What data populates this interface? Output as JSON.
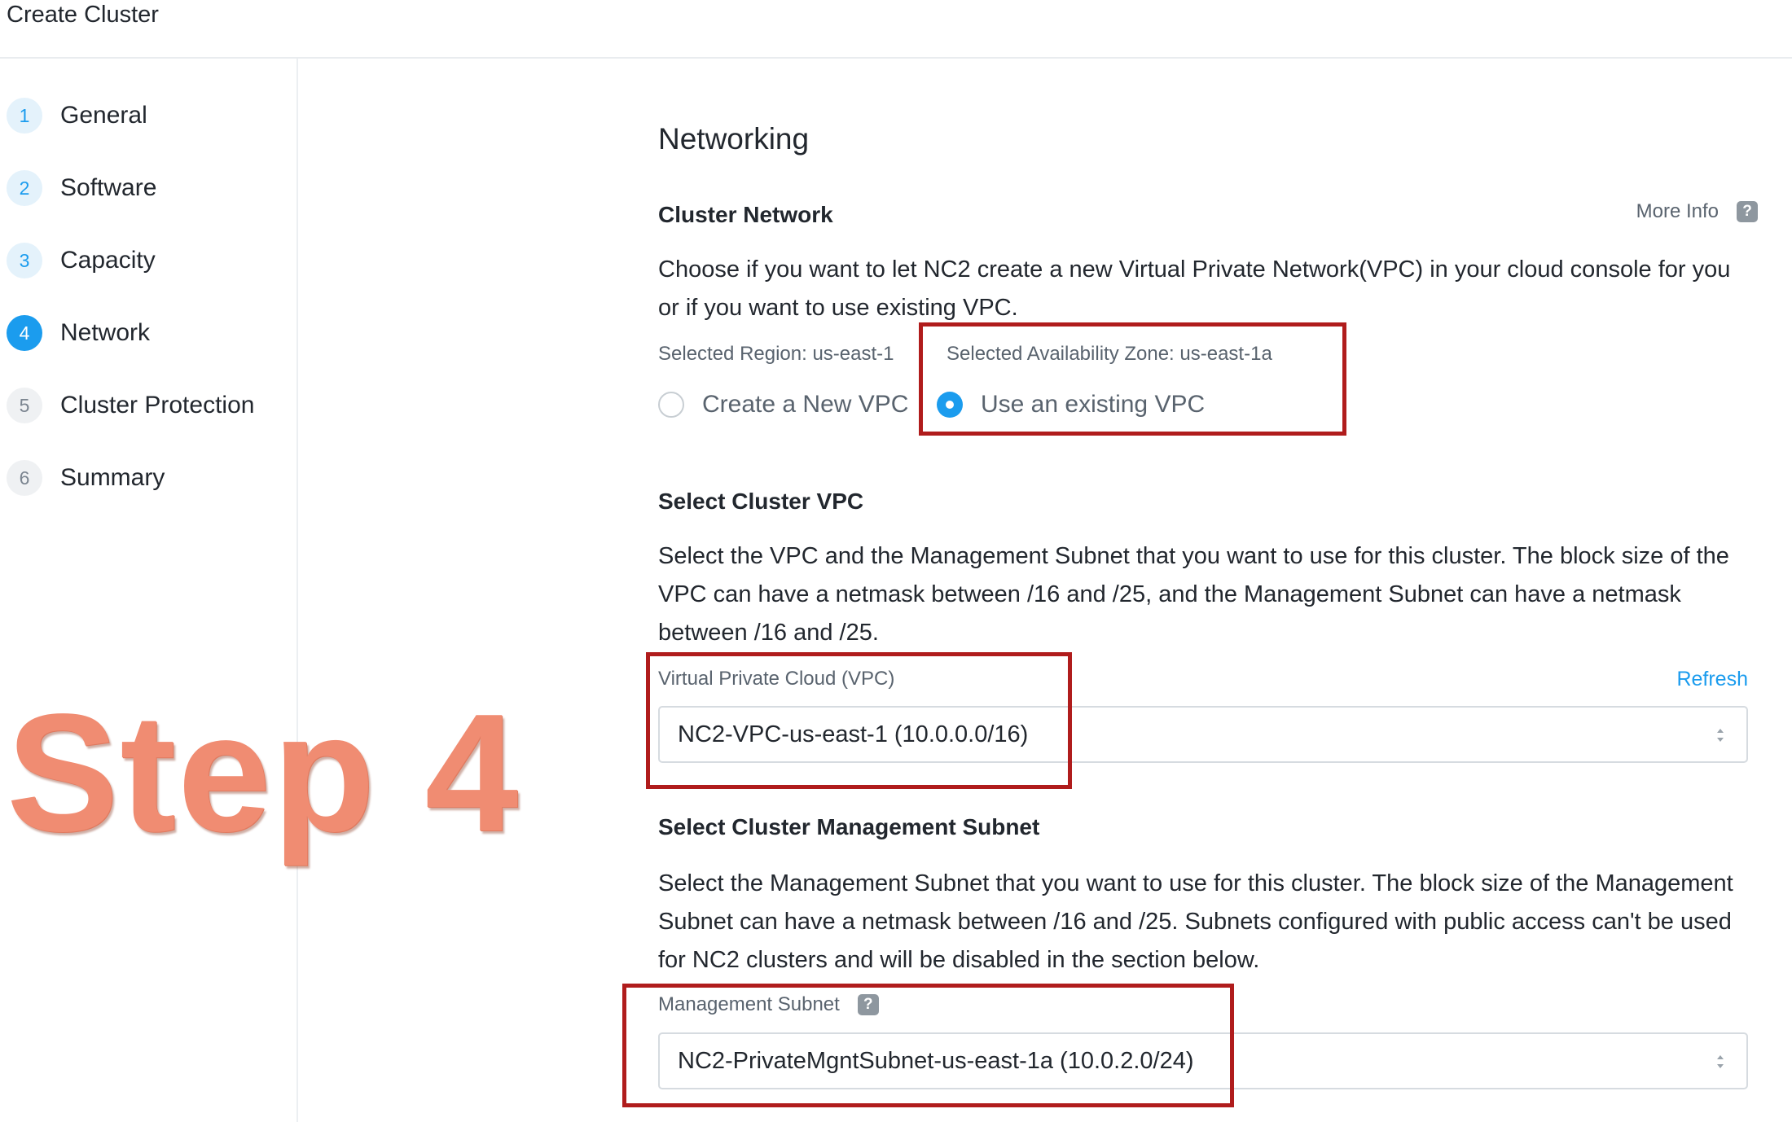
{
  "header": {
    "title": "Create Cluster"
  },
  "sidebar": {
    "steps": [
      {
        "num": "1",
        "label": "General",
        "state": "done"
      },
      {
        "num": "2",
        "label": "Software",
        "state": "done"
      },
      {
        "num": "3",
        "label": "Capacity",
        "state": "done"
      },
      {
        "num": "4",
        "label": "Network",
        "state": "active"
      },
      {
        "num": "5",
        "label": "Cluster Protection",
        "state": "pending"
      },
      {
        "num": "6",
        "label": "Summary",
        "state": "pending"
      }
    ]
  },
  "overlay": {
    "step_text": "Step 4",
    "color": "#f08c72",
    "highlight_color": "#b01c1c"
  },
  "main": {
    "section_title": "Networking",
    "cluster_network": {
      "heading": "Cluster Network",
      "more_info": "More Info",
      "help_icon": "question-icon",
      "description": "Choose if you want to let NC2 create a new Virtual Private Network(VPC) in your cloud console for you or if you want to use existing VPC.",
      "selected_region": "Selected Region: us-east-1",
      "selected_az": "Selected Availability Zone: us-east-1a",
      "option_new": "Create a New VPC",
      "option_existing": "Use an existing VPC",
      "selected_option": "Use an existing VPC"
    },
    "cluster_vpc": {
      "heading": "Select Cluster VPC",
      "description": "Select the VPC and the Management Subnet that you want to use for this cluster. The block size of the VPC can have a netmask between /16 and /25, and the Management Subnet can have a netmask between /16 and /25.",
      "field_label": "Virtual Private Cloud (VPC)",
      "refresh": "Refresh",
      "value": "NC2-VPC-us-east-1 (10.0.0.0/16)"
    },
    "mgmt_subnet": {
      "heading": "Select Cluster Management Subnet",
      "description": "Select the Management Subnet that you want to use for this cluster. The block size of the Management Subnet can have a netmask between /16 and /25. Subnets configured with public access can't be used for NC2 clusters and will be disabled in the section below.",
      "field_label": "Management Subnet",
      "value": "NC2-PrivateMgntSubnet-us-east-1a (10.0.2.0/24)"
    }
  },
  "colors": {
    "accent": "#1b9cee",
    "text": "#22272e",
    "muted": "#59636e"
  }
}
